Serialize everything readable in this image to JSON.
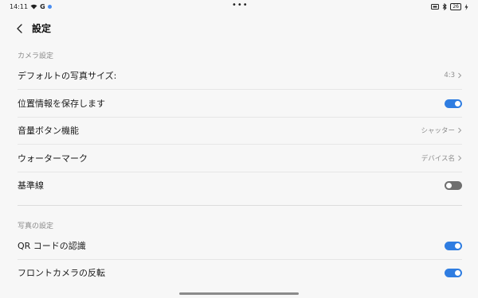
{
  "status_bar": {
    "time": "14:11",
    "g_label": "G",
    "center_dots": "•••",
    "battery": "26"
  },
  "header": {
    "title": "設定"
  },
  "sections": [
    {
      "title": "カメラ設定",
      "rows": [
        {
          "label": "デフォルトの写真サイズ:",
          "value": "4:3"
        },
        {
          "label": "位置情報を保存します",
          "toggle": true
        },
        {
          "label": "音量ボタン機能",
          "value": "シャッター"
        },
        {
          "label": "ウォーターマーク",
          "value": "デバイス名"
        },
        {
          "label": "基準線",
          "toggle": false
        }
      ]
    },
    {
      "title": "写真の設定",
      "rows": [
        {
          "label": "QR コードの認識",
          "toggle": true
        },
        {
          "label": "フロントカメラの反転",
          "toggle": true
        }
      ]
    }
  ],
  "colors": {
    "accent": "#2f7de1",
    "toggle_off": "#6f6f6f"
  }
}
